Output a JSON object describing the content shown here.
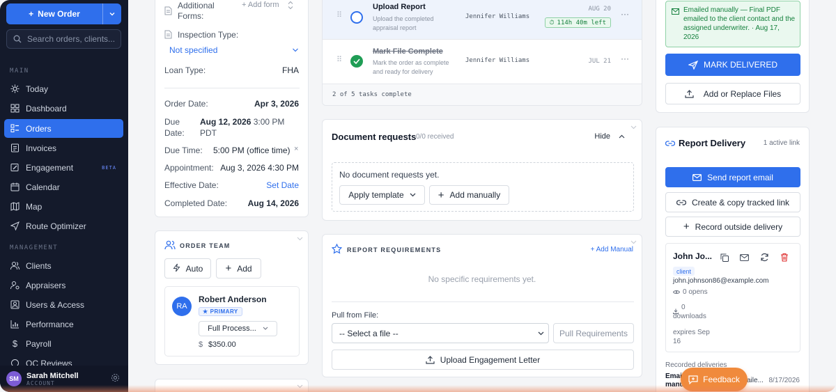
{
  "sidebar": {
    "new_order": "New Order",
    "search_placeholder": "Search orders, clients...",
    "section_main": "MAIN",
    "section_management": "MANAGEMENT",
    "items": [
      {
        "label": "Today",
        "icon": "sun-icon"
      },
      {
        "label": "Dashboard",
        "icon": "dashboard-icon"
      },
      {
        "label": "Orders",
        "icon": "orders-icon",
        "active": true
      },
      {
        "label": "Invoices",
        "icon": "invoice-icon"
      },
      {
        "label": "Engagement",
        "icon": "engagement-icon",
        "badge": "BETA"
      },
      {
        "label": "Calendar",
        "icon": "calendar-icon"
      },
      {
        "label": "Map",
        "icon": "map-icon"
      },
      {
        "label": "Route Optimizer",
        "icon": "route-icon"
      }
    ],
    "mgmt_items": [
      {
        "label": "Clients",
        "icon": "clients-icon"
      },
      {
        "label": "Appraisers",
        "icon": "appraisers-icon"
      },
      {
        "label": "Users & Access",
        "icon": "users-icon"
      },
      {
        "label": "Performance",
        "icon": "performance-icon"
      },
      {
        "label": "Payroll",
        "icon": "payroll-icon"
      },
      {
        "label": "QC Reviews",
        "icon": "qc-icon"
      }
    ],
    "user": {
      "initials": "SM",
      "name": "Sarah Mitchell",
      "role": "ACCOUNT"
    }
  },
  "details": {
    "additional_forms_label": "Additional Forms:",
    "add_form": "+ Add form",
    "inspection_type_label": "Inspection Type:",
    "inspection_type_value": "Not specified",
    "loan_type_label": "Loan Type:",
    "loan_type_value": "FHA",
    "order_date_label": "Order Date:",
    "order_date_value": "Apr 3, 2026",
    "due_date_label": "Due Date:",
    "due_date_value": "Aug 12, 2026",
    "due_date_time": "3:00 PM PDT",
    "due_time_label": "Due Time:",
    "due_time_value": "5:00 PM (office time)",
    "appointment_label": "Appointment:",
    "appointment_value": "Aug 3, 2026 4:30 PM",
    "effective_date_label": "Effective Date:",
    "effective_date_value": "Set Date",
    "completed_date_label": "Completed Date:",
    "completed_date_value": "Aug 14, 2026"
  },
  "team": {
    "title": "ORDER TEAM",
    "auto": "Auto",
    "add": "Add",
    "member_initials": "RA",
    "member_name": "Robert Anderson",
    "member_badge": "PRIMARY",
    "member_role": "Full Process...",
    "member_fee": "$350.00"
  },
  "tasks": {
    "items": [
      {
        "title": "Upload Report",
        "desc": "Upload the completed appraisal report",
        "assignee": "Jennifer Williams",
        "date": "AUG 20",
        "timer": "114h 40m left",
        "done": false
      },
      {
        "title": "Mark File Complete",
        "desc": "Mark the order as complete and ready for delivery",
        "assignee": "Jennifer Williams",
        "date": "JUL 21",
        "done": true
      }
    ],
    "progress": "2 of 5 tasks complete"
  },
  "doc_requests": {
    "title": "Document requests",
    "count": "0/0 received",
    "hide": "Hide",
    "empty": "No document requests yet.",
    "apply_template": "Apply template",
    "add_manually": "Add manually"
  },
  "requirements": {
    "title": "REPORT REQUIREMENTS",
    "add_manual": "+ Add Manual",
    "empty": "No specific requirements yet.",
    "pull_label": "Pull from File:",
    "select_placeholder": "-- Select a file --",
    "pull_button": "Pull Requirements",
    "upload_button": "Upload Engagement Letter"
  },
  "delivery_top": {
    "notice": "Emailed manually — Final PDF emailed to the client contact and the assigned underwriter. · Aug 17, 2026",
    "mark_delivered": "MARK DELIVERED",
    "add_replace": "Add or Replace Files"
  },
  "report_delivery": {
    "title": "Report Delivery",
    "active": "1 active link",
    "send_email": "Send report email",
    "create_link": "Create & copy tracked link",
    "record_outside": "Record outside delivery",
    "contact_name": "John Jo...",
    "contact_tag": "client",
    "contact_email": "john.johnson86@example.com",
    "opens": "0 opens",
    "downloads_count": "0",
    "downloads_label": "downloads",
    "expires": "expires Sep 16",
    "recorded_label": "Recorded deliveries",
    "recorded_line1": "Email",
    "recorded_line2": "manu",
    "recorded_partial": "aile...",
    "recorded_date": "8/17/2026"
  },
  "feedback": {
    "label": "Feedback"
  },
  "colors": {
    "accent": "#2f6fec",
    "sidebar": "#141a2b",
    "success": "#16a34a",
    "danger": "#dc2626",
    "feedback": "#f08a3c"
  }
}
